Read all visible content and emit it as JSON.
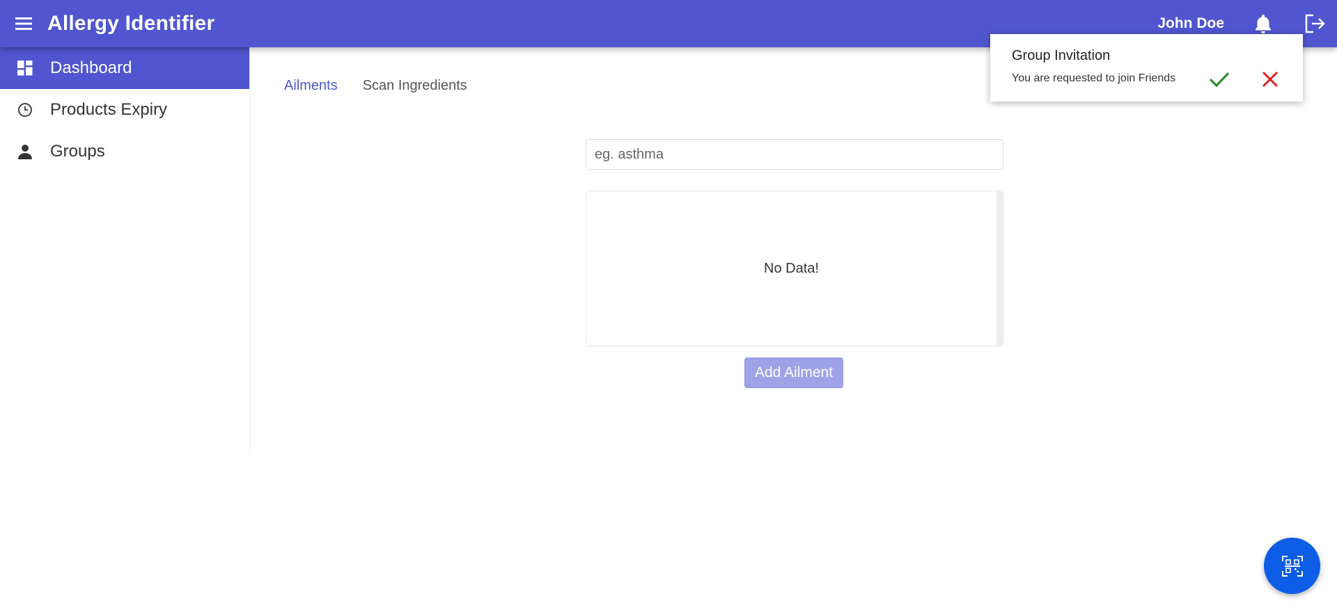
{
  "header": {
    "app_title": "Allergy Identifier",
    "user_name": "John Doe",
    "menu_icon": "hamburger-icon",
    "bell_icon": "bell-icon",
    "logout_icon": "logout-icon",
    "color": "#4f56cf"
  },
  "sidebar": {
    "items": [
      {
        "label": "Dashboard",
        "icon": "dashboard-icon",
        "active": true
      },
      {
        "label": "Products Expiry",
        "icon": "clock-icon",
        "active": false
      },
      {
        "label": "Groups",
        "icon": "person-icon",
        "active": false
      }
    ]
  },
  "main": {
    "tabs": [
      {
        "label": "Ailments",
        "active": true
      },
      {
        "label": "Scan Ingredients",
        "active": false
      }
    ],
    "search": {
      "placeholder": "eg. asthma",
      "value": ""
    },
    "list": {
      "empty_text": "No Data!"
    },
    "add_button_label": "Add Ailment"
  },
  "notification": {
    "title": "Group Invitation",
    "message": "You are requested to join Friends",
    "accept_icon": "check-icon",
    "decline_icon": "close-icon",
    "accept_color": "#1e8a1e",
    "decline_color": "#e02020"
  },
  "fab": {
    "icon": "qr-scan-icon",
    "color": "#0d5de6"
  }
}
